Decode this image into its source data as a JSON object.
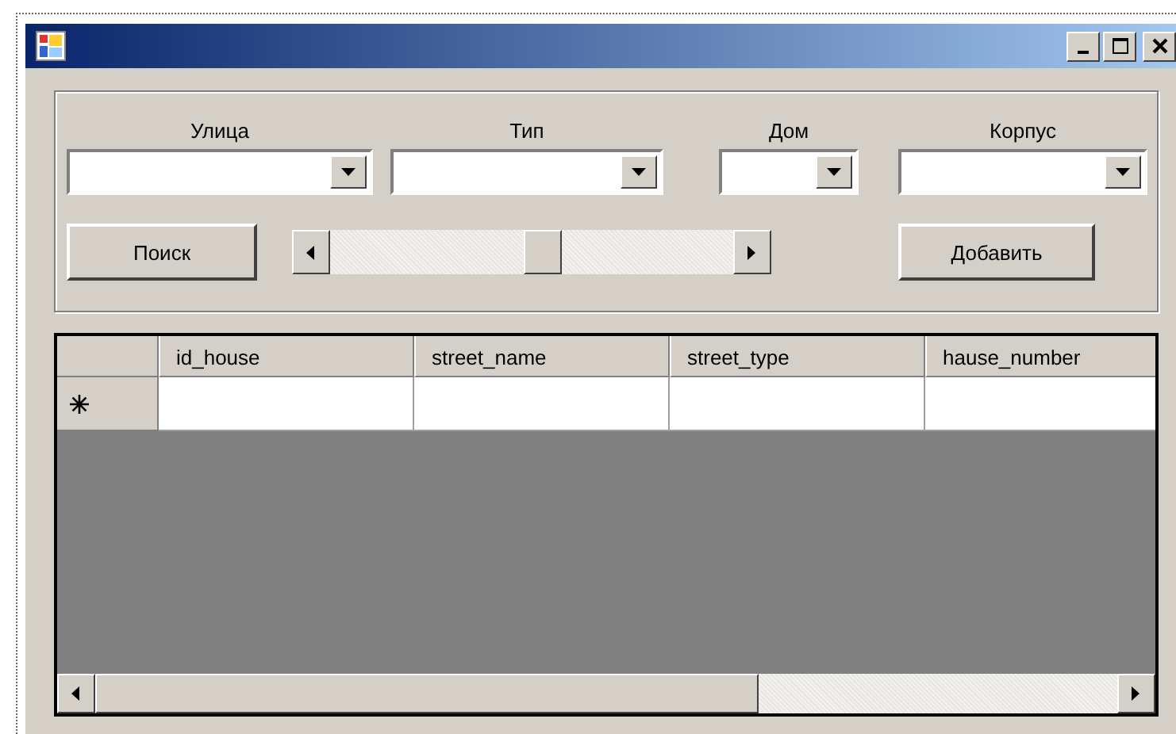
{
  "filters": [
    {
      "label": "Улица",
      "kind": "combo"
    },
    {
      "label": "Тип",
      "kind": "combo"
    },
    {
      "label": "Дом",
      "kind": "combo"
    },
    {
      "label": "Корпус",
      "kind": "combo"
    }
  ],
  "search_button": "Поиск",
  "add_button": "Добавить",
  "grid": {
    "columns": [
      "id_house",
      "street_name",
      "street_type",
      "hause_number"
    ]
  }
}
